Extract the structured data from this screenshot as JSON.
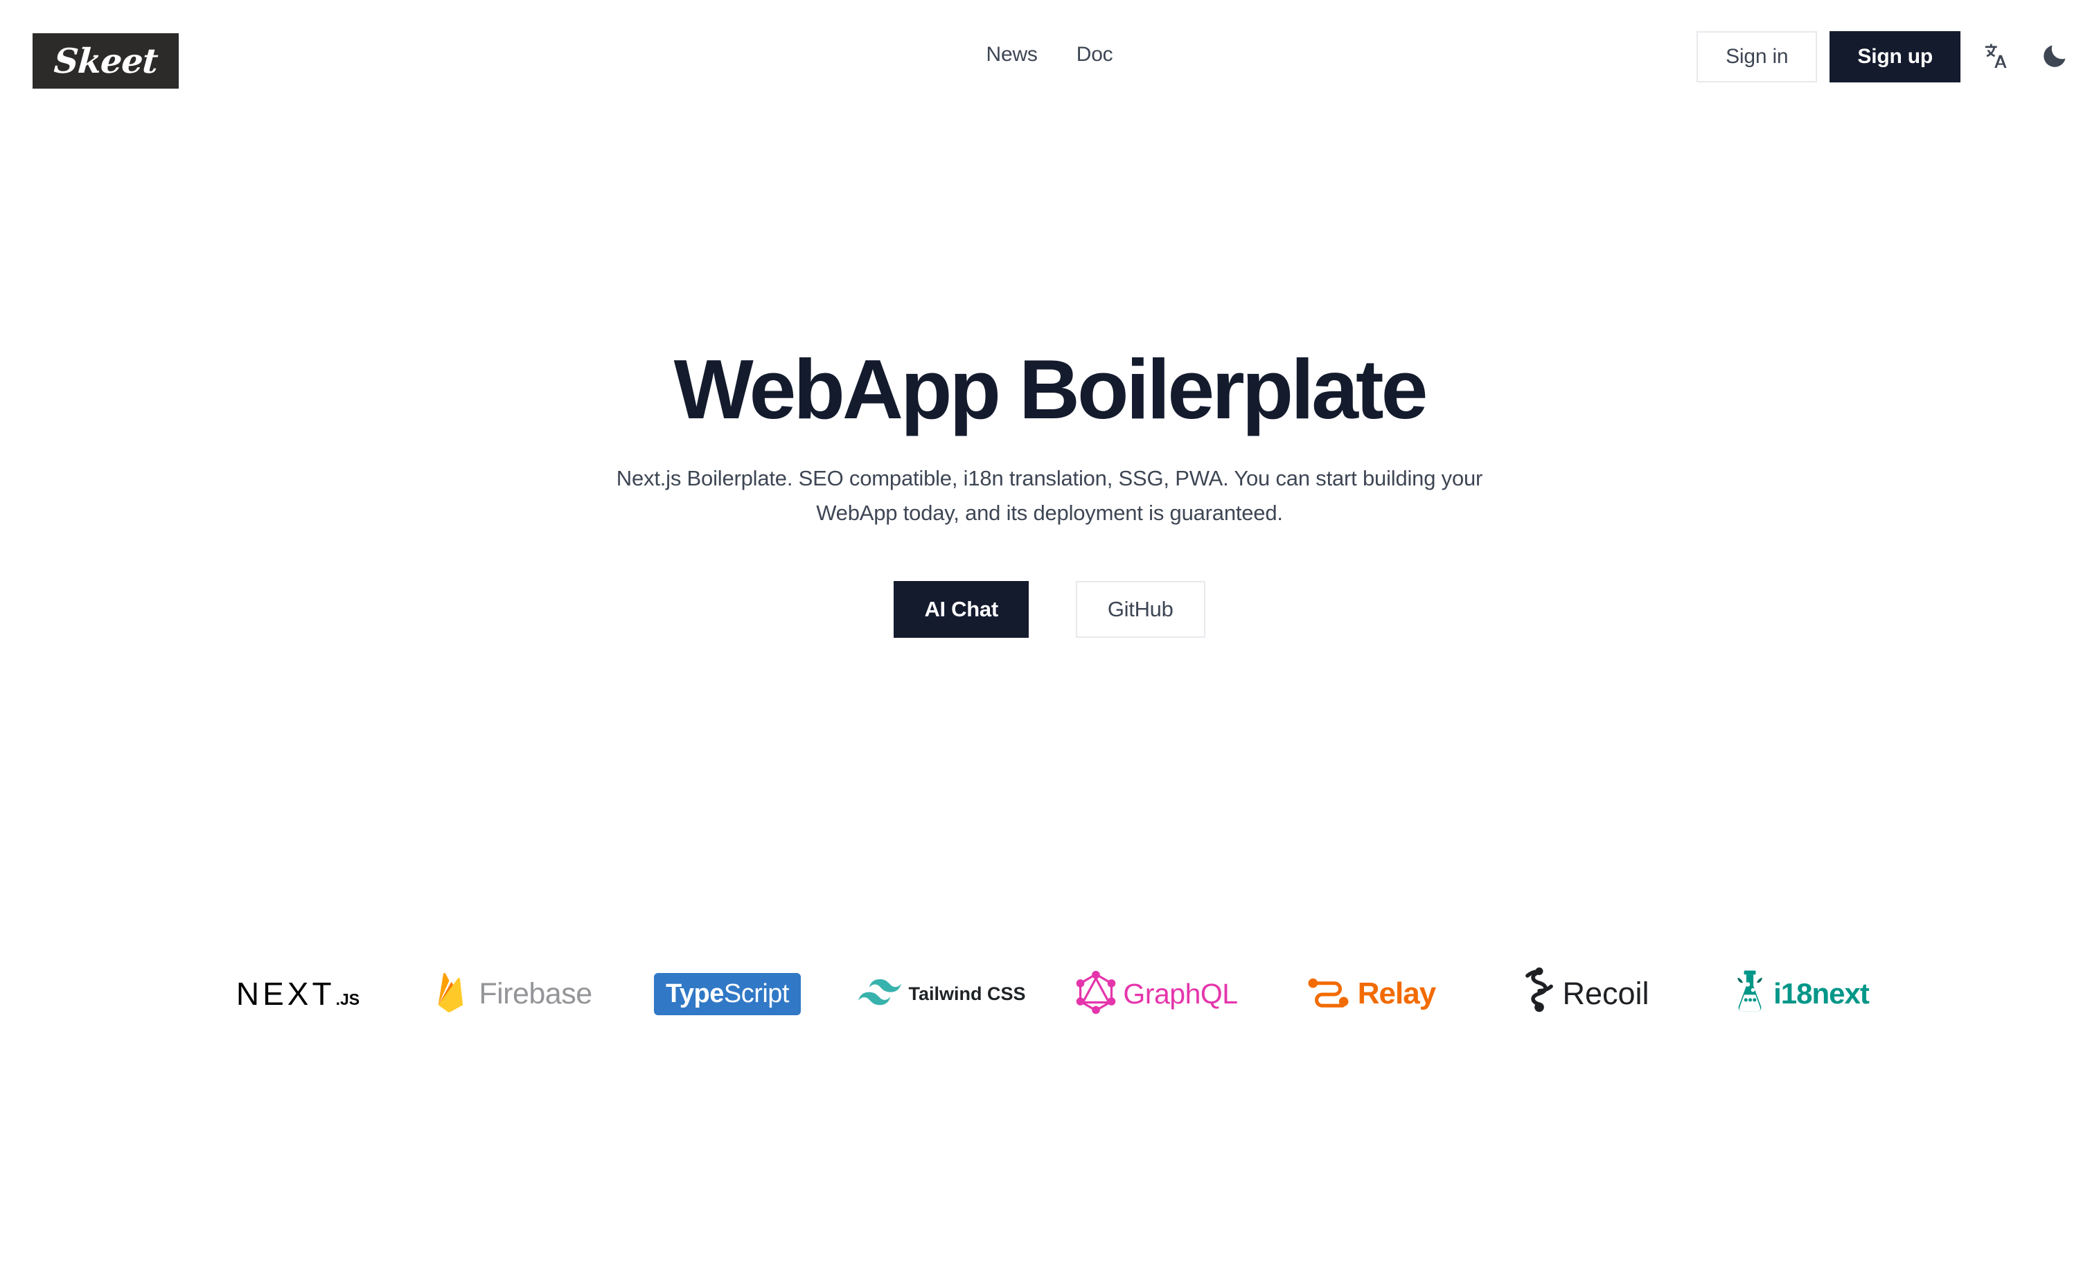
{
  "brand": {
    "name": "Skeet"
  },
  "header": {
    "nav": [
      {
        "label": "News",
        "name": "nav-link-news"
      },
      {
        "label": "Doc",
        "name": "nav-link-doc"
      }
    ],
    "sign_in_label": "Sign in",
    "sign_up_label": "Sign up",
    "language_icon": "translate-icon",
    "theme_icon": "moon-icon"
  },
  "hero": {
    "title": "WebApp Boilerplate",
    "subtitle": "Next.js Boilerplate. SEO compatible, i18n translation, SSG, PWA. You can start building your WebApp today, and its deployment is guaranteed.",
    "primary_cta": "AI Chat",
    "secondary_cta": "GitHub"
  },
  "tech_logos": [
    {
      "name": "nextjs",
      "main": "NEXT",
      "suffix": ".JS",
      "color": "#000000"
    },
    {
      "name": "firebase",
      "label": "Firebase",
      "color": "#939598",
      "accent": "#ffa000"
    },
    {
      "name": "typescript",
      "part_a": "Type",
      "part_b": "Script",
      "color": "#3178c6"
    },
    {
      "name": "tailwindcss",
      "label": "Tailwind CSS",
      "color": "#1f2326",
      "accent": "#38b2ac"
    },
    {
      "name": "graphql",
      "label": "GraphQL",
      "color": "#e535ab"
    },
    {
      "name": "relay",
      "label": "Relay",
      "color": "#f26b00"
    },
    {
      "name": "recoil",
      "label": "Recoil",
      "color": "#1e2023"
    },
    {
      "name": "i18next",
      "label": "i18next",
      "color": "#009688"
    }
  ],
  "colors": {
    "ink": "#141b2d",
    "body_text": "#3e4654",
    "border": "#e7e9ec",
    "logo_box": "#2c2b29",
    "background": "#ffffff"
  }
}
